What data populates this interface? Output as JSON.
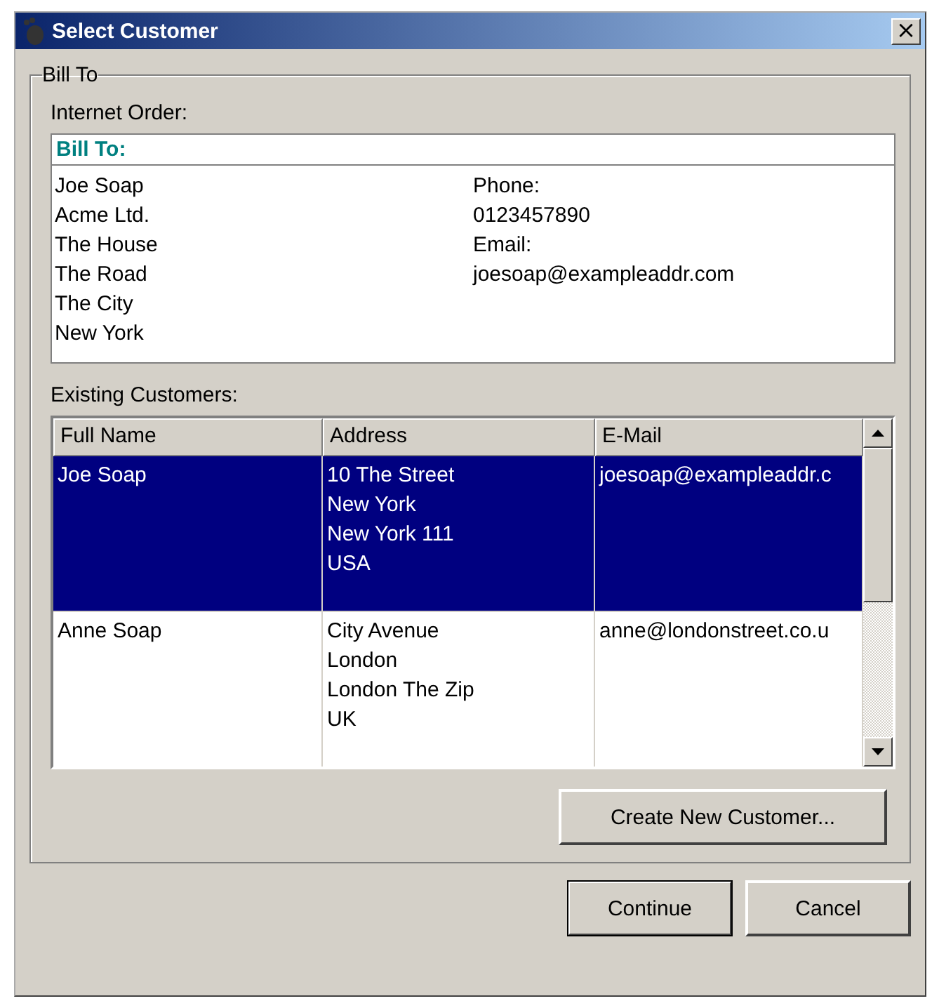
{
  "window": {
    "title": "Select Customer",
    "close": "×"
  },
  "group": {
    "legend": "Bill To"
  },
  "internet_order": {
    "label": "Internet Order:",
    "heading": "Bill To:",
    "left_lines": [
      "Joe Soap",
      "Acme Ltd.",
      "The House",
      "The Road",
      "The City",
      "New York"
    ],
    "right_lines": [
      "Phone:",
      "0123457890",
      "Email:",
      "joesoap@exampleaddr.com"
    ]
  },
  "customers": {
    "label": "Existing Customers:",
    "columns": [
      "Full Name",
      "Address",
      "E-Mail"
    ],
    "rows": [
      {
        "name": "Joe Soap",
        "address": [
          "10 The Street",
          "New York",
          "New York 111",
          "USA"
        ],
        "email": "joesoap@exampleaddr.c",
        "selected": true
      },
      {
        "name": "Anne Soap",
        "address": [
          "City Avenue",
          "London",
          "London The Zip",
          "UK"
        ],
        "email": "anne@londonstreet.co.u",
        "selected": false
      }
    ]
  },
  "create_button": "Create New Customer...",
  "buttons": [
    {
      "label": "Continue",
      "default": true
    },
    {
      "label": "Cancel",
      "default": false
    }
  ]
}
